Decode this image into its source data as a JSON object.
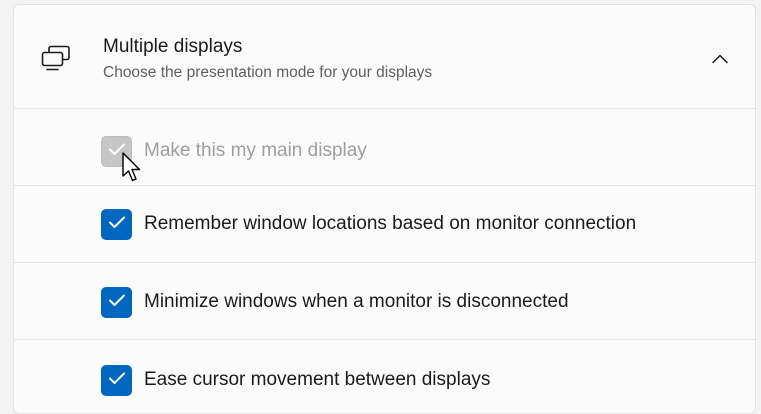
{
  "section": {
    "title": "Multiple displays",
    "subtitle": "Choose the presentation mode for your displays",
    "icon": "multiple-displays-icon",
    "collapse_icon": "chevron-up-icon"
  },
  "options": [
    {
      "label": "Make this my main display",
      "checked": true,
      "disabled": true
    },
    {
      "label": "Remember window locations based on monitor connection",
      "checked": true,
      "disabled": false
    },
    {
      "label": "Minimize windows when a monitor is disconnected",
      "checked": true,
      "disabled": false
    },
    {
      "label": "Ease cursor movement between displays",
      "checked": true,
      "disabled": false
    }
  ],
  "colors": {
    "accent": "#0067c0",
    "disabled_checkbox": "#c6c6c6",
    "background": "#f3f3f3",
    "card": "#fbfbfb"
  }
}
